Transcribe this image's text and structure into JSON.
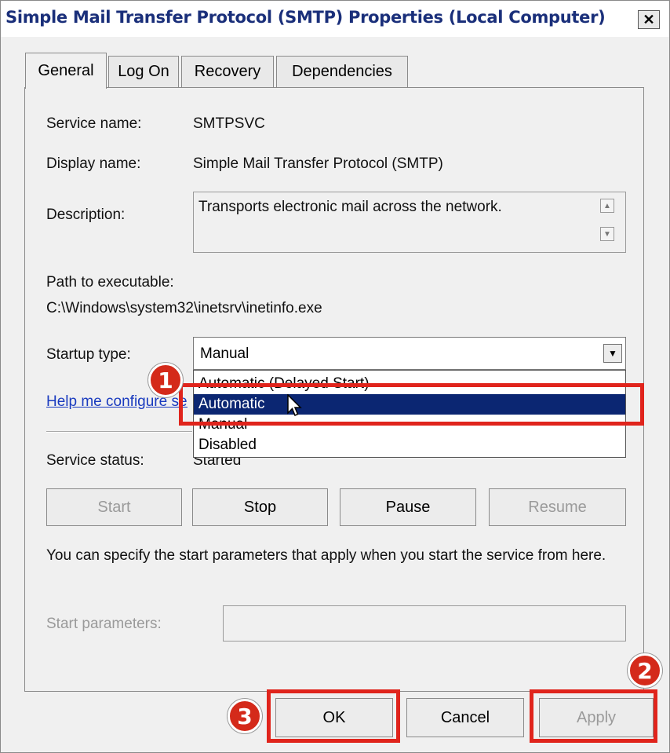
{
  "window": {
    "title": "Simple Mail Transfer Protocol (SMTP) Properties (Local Computer)",
    "close_glyph": "✕"
  },
  "tabs": [
    {
      "label": "General",
      "active": true
    },
    {
      "label": "Log On",
      "active": false
    },
    {
      "label": "Recovery",
      "active": false
    },
    {
      "label": "Dependencies",
      "active": false
    }
  ],
  "general": {
    "service_name_label": "Service name:",
    "service_name_value": "SMTPSVC",
    "display_name_label": "Display name:",
    "display_name_value": "Simple Mail Transfer Protocol (SMTP)",
    "description_label": "Description:",
    "description_value": "Transports electronic mail across the network.",
    "path_label": "Path to executable:",
    "path_value": "C:\\Windows\\system32\\inetsrv\\inetinfo.exe",
    "startup_type_label": "Startup type:",
    "startup_type_value": "Manual",
    "startup_options": [
      "Automatic (Delayed Start)",
      "Automatic",
      "Manual",
      "Disabled"
    ],
    "startup_highlighted": "Automatic",
    "help_link": "Help me configure service startup options.",
    "service_status_label": "Service status:",
    "service_status_value": "Started",
    "buttons": {
      "start": "Start",
      "stop": "Stop",
      "pause": "Pause",
      "resume": "Resume"
    },
    "hint_text": "You can specify the start parameters that apply when you start the service from here.",
    "start_parameters_label": "Start parameters:",
    "start_parameters_value": ""
  },
  "footer": {
    "ok": "OK",
    "cancel": "Cancel",
    "apply": "Apply"
  },
  "annotations": {
    "step1": "1",
    "step2": "2",
    "step3": "3"
  },
  "colors": {
    "annotation_red": "#e0241c",
    "selection_blue": "#0b2672",
    "title_blue": "#1a2f7a"
  }
}
